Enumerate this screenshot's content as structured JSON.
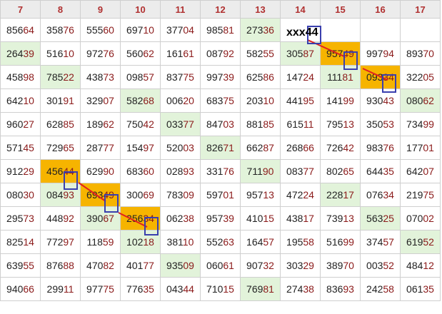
{
  "headers": [
    "7",
    "8",
    "9",
    "10",
    "11",
    "12",
    "13",
    "14",
    "15",
    "16",
    "17"
  ],
  "rows": [
    [
      "85664",
      "35876",
      "55560",
      "69710",
      "37704",
      "98581",
      "27336",
      "",
      "",
      "",
      ""
    ],
    [
      "26439",
      "51610",
      "97276",
      "56062",
      "16161",
      "08792",
      "58255",
      "30587",
      "95749",
      "99794",
      "89370"
    ],
    [
      "45898",
      "78522",
      "43873",
      "09857",
      "83775",
      "99739",
      "62586",
      "14724",
      "11181",
      "09334",
      "32205"
    ],
    [
      "64210",
      "30191",
      "32907",
      "58268",
      "00620",
      "68375",
      "20310",
      "44195",
      "14199",
      "93043",
      "08062"
    ],
    [
      "96027",
      "62885",
      "18962",
      "75042",
      "03377",
      "84703",
      "88185",
      "61511",
      "79513",
      "35053",
      "73499"
    ],
    [
      "57145",
      "72965",
      "28777",
      "15497",
      "52003",
      "82671",
      "66287",
      "26866",
      "72642",
      "98376",
      "17701"
    ],
    [
      "91229",
      "45644",
      "62990",
      "68360",
      "02893",
      "33176",
      "71190",
      "08377",
      "80265",
      "64435",
      "64207"
    ],
    [
      "08030",
      "08493",
      "69349",
      "30069",
      "78309",
      "59701",
      "95713",
      "47224",
      "22817",
      "07634",
      "21975"
    ],
    [
      "29573",
      "44892",
      "39067",
      "25634",
      "06238",
      "95739",
      "41015",
      "43817",
      "73913",
      "56325",
      "07002"
    ],
    [
      "82514",
      "77297",
      "11859",
      "10218",
      "38110",
      "55263",
      "16457",
      "19558",
      "51699",
      "37457",
      "61952"
    ],
    [
      "63955",
      "87688",
      "47082",
      "40177",
      "93509",
      "06061",
      "90732",
      "30329",
      "38970",
      "00352",
      "48412"
    ],
    [
      "94066",
      "29911",
      "97775",
      "77635",
      "04344",
      "71015",
      "76981",
      "27438",
      "83693",
      "24258",
      "06135"
    ]
  ],
  "green_cells": [
    [
      0,
      6
    ],
    [
      1,
      0
    ],
    [
      1,
      7
    ],
    [
      2,
      1
    ],
    [
      2,
      8
    ],
    [
      3,
      3
    ],
    [
      3,
      10
    ],
    [
      4,
      4
    ],
    [
      5,
      5
    ],
    [
      6,
      6
    ],
    [
      7,
      1
    ],
    [
      7,
      8
    ],
    [
      8,
      2
    ],
    [
      8,
      9
    ],
    [
      9,
      3
    ],
    [
      9,
      10
    ],
    [
      10,
      4
    ],
    [
      11,
      6
    ]
  ],
  "yellow_cells": [
    [
      1,
      8
    ],
    [
      2,
      9
    ],
    [
      6,
      1
    ],
    [
      7,
      2
    ],
    [
      8,
      3
    ]
  ],
  "prediction_label": "xxx44",
  "colors": {
    "header_bg": "#ececec",
    "header_text": "#b03030",
    "green": "#e2f3da",
    "yellow": "#f6b400",
    "box": "#3a3fae",
    "line": "#e02020",
    "digit_highlight": "#8b1a1a"
  }
}
